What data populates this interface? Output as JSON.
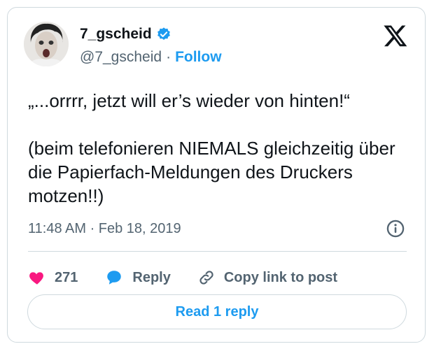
{
  "author": {
    "display_name": "7_gscheid",
    "handle": "@7_gscheid",
    "separator": "·",
    "follow_label": "Follow"
  },
  "tweet": {
    "text": "„...orrrr, jetzt will er’s wieder von hinten!“\n\n(beim telefonieren NIEMALS gleichzeitig über die Papierfach-Meldungen des Druckers motzen!!)",
    "timestamp": "11:48 AM · Feb 18, 2019"
  },
  "actions": {
    "like_count": "271",
    "reply_label": "Reply",
    "copy_link_label": "Copy link to post"
  },
  "read_replies_label": "Read 1 reply",
  "icons": {
    "verified": "verified-badge-icon",
    "logo": "x-logo-icon",
    "info": "info-icon",
    "like": "heart-icon",
    "reply": "speech-bubble-icon",
    "link": "link-icon"
  },
  "colors": {
    "accent": "#1d9bf0",
    "like": "#f91880",
    "secondary_text": "#536471",
    "border": "#cfd9de"
  }
}
